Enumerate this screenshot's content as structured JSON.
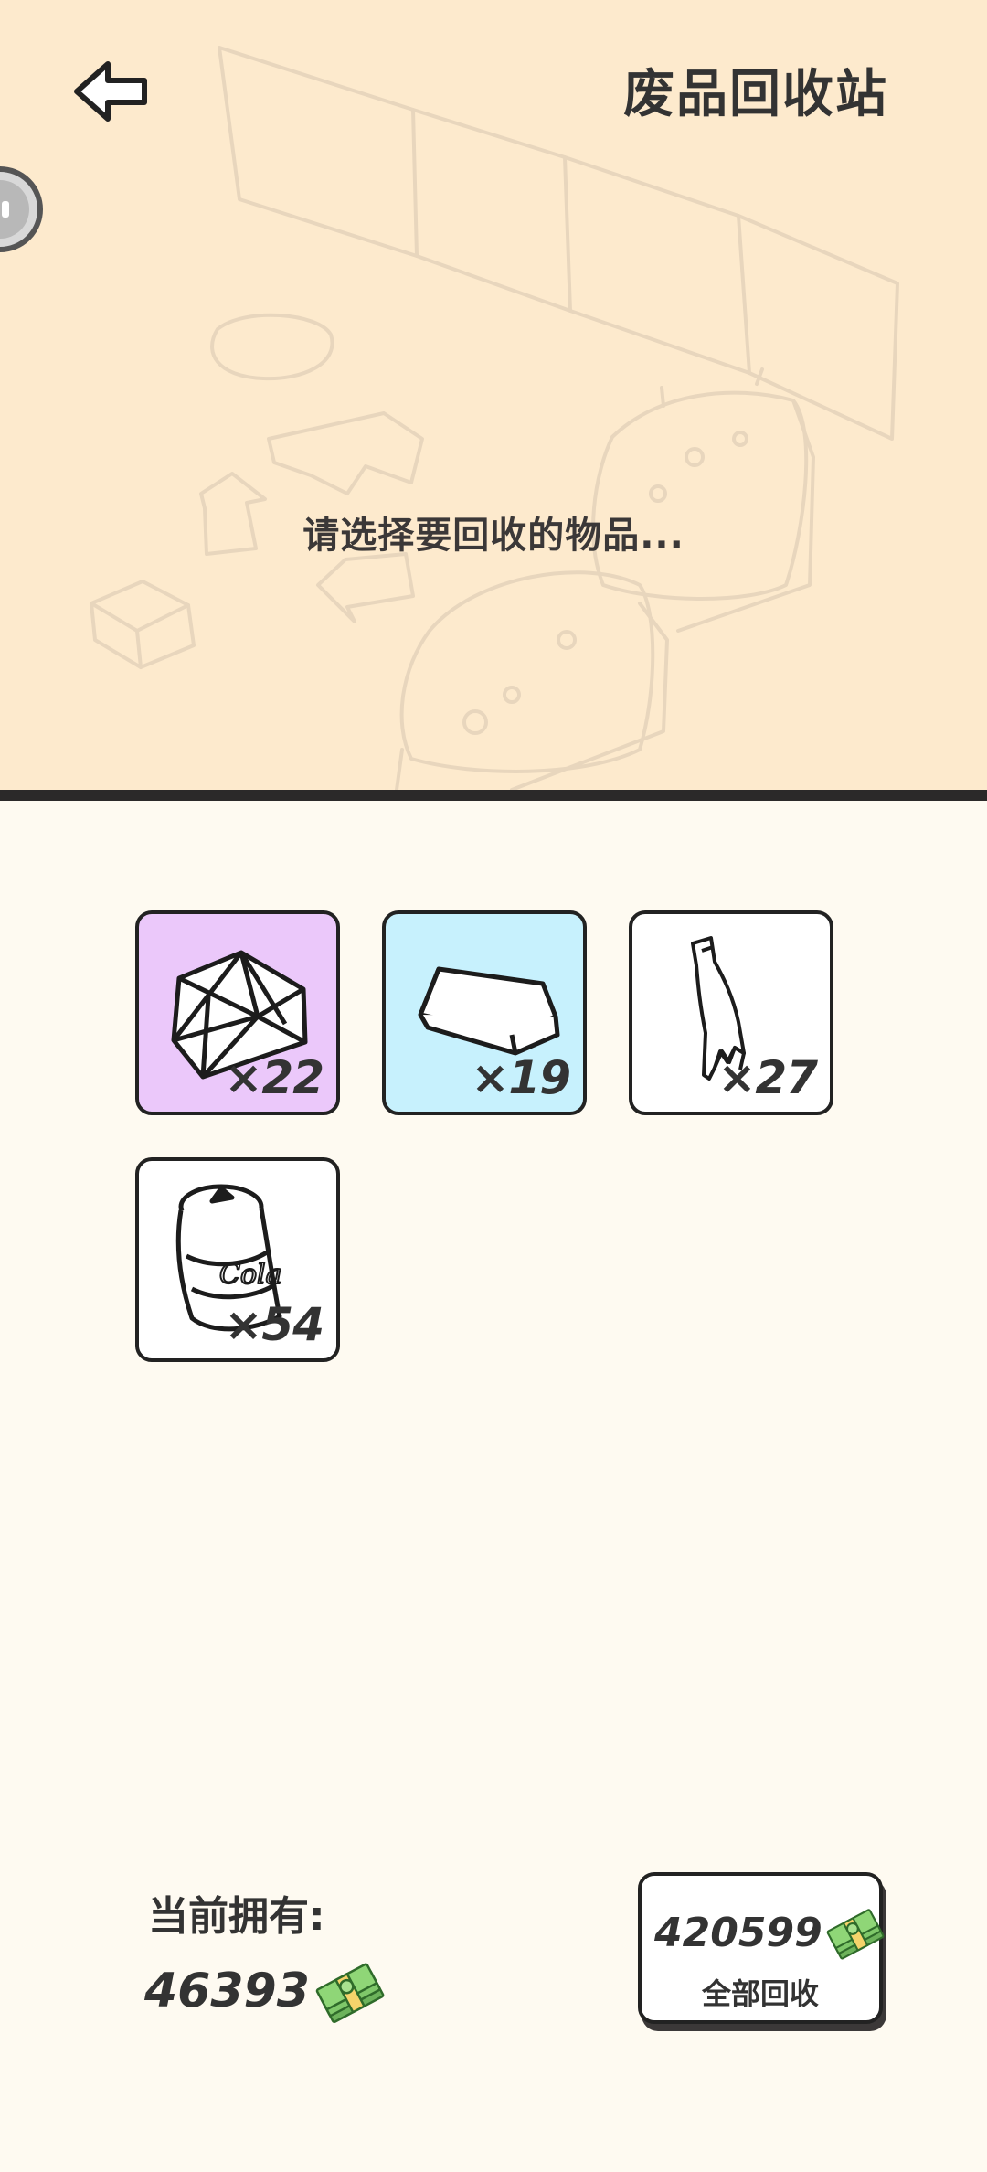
{
  "header": {
    "title": "废品回收站",
    "back_icon": "back-arrow-icon"
  },
  "prompt": "请选择要回收的物品...",
  "items": [
    {
      "name": "gem",
      "count": "×22",
      "bg": "#ebc8fa",
      "icon": "gem-icon"
    },
    {
      "name": "silver-bar",
      "count": "×19",
      "bg": "#c7f1fd",
      "icon": "metal-bar-icon"
    },
    {
      "name": "broken-bottle",
      "count": "×27",
      "bg": "#ffffff",
      "icon": "broken-bottle-icon"
    },
    {
      "name": "cola-can",
      "count": "×54",
      "bg": "#ffffff",
      "icon": "cola-can-icon"
    }
  ],
  "wallet": {
    "label": "当前拥有:",
    "amount": "46393",
    "currency_icon": "cash-stack-icon"
  },
  "recycle_all": {
    "amount": "420599",
    "label": "全部回收",
    "currency_icon": "cash-stack-icon"
  },
  "colors": {
    "top_panel": "#fdeacd",
    "body": "#fefaf1",
    "divider": "#2b2929",
    "cash": "#7fc86a"
  }
}
